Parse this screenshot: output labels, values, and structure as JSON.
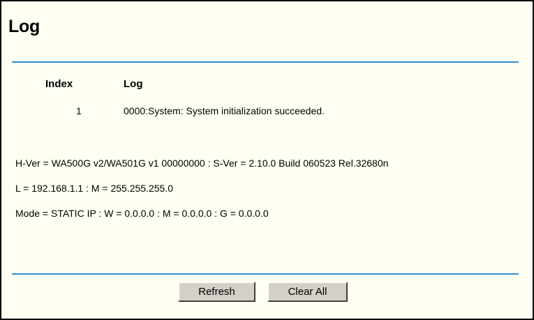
{
  "page": {
    "title": "Log"
  },
  "log_table": {
    "headers": {
      "index": "Index",
      "log": "Log"
    },
    "rows": [
      {
        "index": "1",
        "log": "0000:System: System initialization succeeded."
      }
    ]
  },
  "system_info": {
    "version_line": "H-Ver = WA500G v2/WA501G v1 00000000 : S-Ver = 2.10.0 Build 060523 Rel.32680n",
    "lan_line": "L = 192.168.1.1 : M = 255.255.255.0",
    "mode_line": "Mode = STATIC IP : W = 0.0.0.0 : M = 0.0.0.0 : G = 0.0.0.0"
  },
  "buttons": {
    "refresh": "Refresh",
    "clear_all": "Clear All"
  },
  "colors": {
    "background": "#fffef2",
    "rule": "#2f8fd3",
    "button_face": "#d4d0c8"
  }
}
